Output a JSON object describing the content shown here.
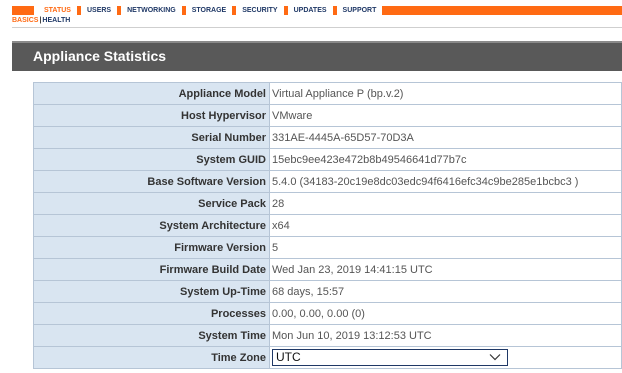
{
  "nav": {
    "tabs": [
      {
        "label": "STATUS",
        "active": true
      },
      {
        "label": "USERS",
        "active": false
      },
      {
        "label": "NETWORKING",
        "active": false
      },
      {
        "label": "STORAGE",
        "active": false
      },
      {
        "label": "SECURITY",
        "active": false
      },
      {
        "label": "UPDATES",
        "active": false
      },
      {
        "label": "SUPPORT",
        "active": false
      }
    ],
    "subtabs": {
      "basics": "BASICS",
      "separator": "|",
      "health": "HEALTH"
    }
  },
  "section": {
    "title": "Appliance Statistics"
  },
  "stats": [
    {
      "label": "Appliance Model",
      "value": "Virtual Appliance P (bp.v.2)"
    },
    {
      "label": "Host Hypervisor",
      "value": "VMware"
    },
    {
      "label": "Serial Number",
      "value": "331AE-4445A-65D57-70D3A"
    },
    {
      "label": "System GUID",
      "value": "15ebc9ee423e472b8b49546641d77b7c"
    },
    {
      "label": "Base Software Version",
      "value": "5.4.0 (34183-20c19e8dc03edc94f6416efc34c9be285e1bcbc3 )"
    },
    {
      "label": "Service Pack",
      "value": "28"
    },
    {
      "label": "System Architecture",
      "value": "x64"
    },
    {
      "label": "Firmware Version",
      "value": "5"
    },
    {
      "label": "Firmware Build Date",
      "value": "Wed Jan 23, 2019 14:41:15 UTC"
    },
    {
      "label": "System Up-Time",
      "value": "68 days, 15:57"
    },
    {
      "label": "Processes",
      "value": "0.00, 0.00, 0.00 (0)"
    },
    {
      "label": "System Time",
      "value": "Mon Jun 10, 2019 13:12:53 UTC"
    }
  ],
  "timezone": {
    "label": "Time Zone",
    "selected": "UTC",
    "icon": "chevron-down-icon"
  },
  "colors": {
    "accent": "#ff6a13",
    "nav_text": "#1f3866",
    "header_bg": "#595959",
    "label_bg": "#d9e5f1"
  }
}
